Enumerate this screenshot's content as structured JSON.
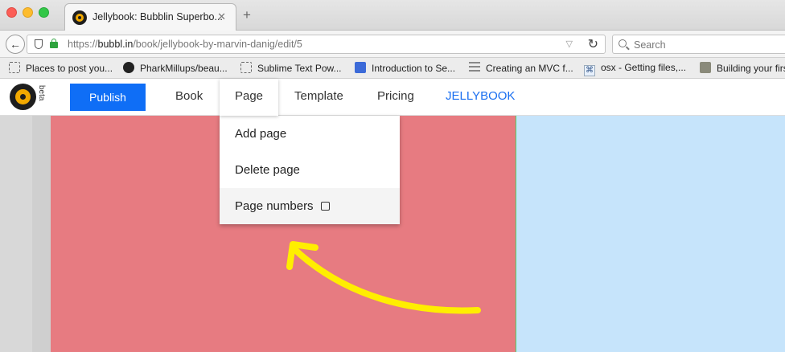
{
  "browser": {
    "tab": {
      "title": "Jellybook: Bubblin Superbo...",
      "close": "✕"
    },
    "new_tab": "+",
    "url": {
      "prefix": "https://",
      "domain": "bubbl.in",
      "path": "/book/jellybook-by-marvin-danig/edit/5"
    },
    "search_placeholder": "Search",
    "bookmarks": [
      {
        "label": "Places to post you...",
        "icon": "page-icon"
      },
      {
        "label": "PharkMillups/beau...",
        "icon": "github-icon"
      },
      {
        "label": "Sublime Text Pow...",
        "icon": "page-icon"
      },
      {
        "label": "Introduction to Se...",
        "icon": "html5-icon"
      },
      {
        "label": "Creating an MVC f...",
        "icon": "sliders-icon"
      },
      {
        "label": "osx - Getting files,...",
        "icon": "command-icon"
      },
      {
        "label": "Building your firs",
        "icon": "tool-icon"
      }
    ]
  },
  "app": {
    "beta": "beta",
    "publish": "Publish",
    "nav": {
      "book": "Book",
      "page": "Page",
      "template": "Template",
      "pricing": "Pricing",
      "brand": "JELLYBOOK"
    },
    "page_menu": {
      "add": "Add page",
      "delete": "Delete page",
      "numbers": "Page numbers",
      "numbers_checked": false
    }
  },
  "colors": {
    "publish": "#0f6ef6",
    "brand": "#1a6ff0",
    "left_page": "#e77b81",
    "right_page": "#c6e4fb",
    "annotation_arrow": "#ffee00"
  }
}
